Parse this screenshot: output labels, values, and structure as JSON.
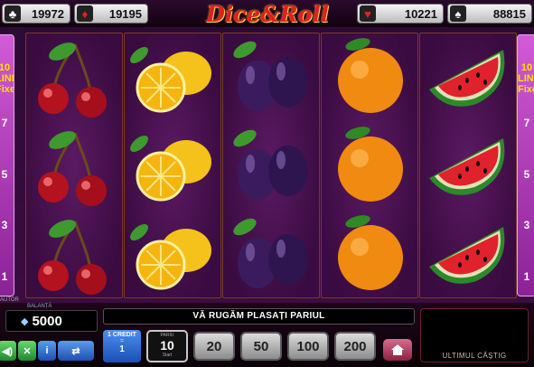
{
  "jackpots": [
    {
      "suit": "clubs",
      "symbol": "♣",
      "value": "19972",
      "sub": "  "
    },
    {
      "suit": "diamonds",
      "symbol": "♦",
      "value": "19195",
      "sub": "  "
    },
    {
      "suit": "hearts",
      "symbol": "♥",
      "value": "10221",
      "sub": "  "
    },
    {
      "suit": "spades",
      "symbol": "♠",
      "value": "88815",
      "sub": "  "
    }
  ],
  "logo": "Dice&Roll",
  "side": {
    "lines_left": "10\nLINES\nFixed",
    "lines_right": "10\nLINES\nFixed",
    "line_numbers": [
      "7",
      "5",
      "3",
      "1"
    ]
  },
  "reels": [
    [
      "cherry",
      "cherry",
      "cherry"
    ],
    [
      "lemon",
      "lemon",
      "lemon"
    ],
    [
      "plum",
      "plum",
      "plum"
    ],
    [
      "orange",
      "orange",
      "orange"
    ],
    [
      "watermelon",
      "watermelon",
      "watermelon"
    ]
  ],
  "bottom": {
    "balance_label": "BALANȚĂ",
    "balance": "5000",
    "auto_label": "AUTOR",
    "message": "VĂ RUGĂM PLASAȚI PARIUL",
    "win_label": "ULTIMUL CÂȘTIG",
    "credit_top": "1 CREDIT",
    "credit_sub": "=",
    "credit_value": "1",
    "bet_label": "PARIU",
    "bet_value": "10",
    "bet_start": "Start",
    "bet_options": [
      "20",
      "50",
      "100",
      "200"
    ]
  },
  "colors": {
    "background": "#3a0d40",
    "reel_border": "#7a3a2a",
    "accent_jackpot": "#ffe000"
  },
  "icons": [
    "sound-icon",
    "expand-icon",
    "info-icon",
    "swap-icon",
    "home-icon"
  ]
}
